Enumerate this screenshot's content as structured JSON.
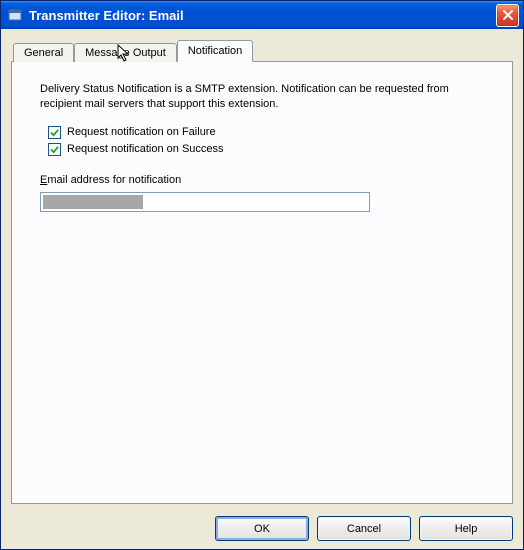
{
  "window": {
    "title": "Transmitter Editor: Email"
  },
  "tabs": {
    "general": "General",
    "message_output": "Message Output",
    "notification": "Notification"
  },
  "panel": {
    "description": "Delivery Status Notification is a SMTP extension. Notification can be requested from recipient mail servers that support this extension.",
    "chk_failure": "Request notification on Failure",
    "chk_success": "Request notification on Success",
    "email_label_prefix": "E",
    "email_label_rest": "mail address for notification",
    "email_value": ""
  },
  "buttons": {
    "ok": "OK",
    "cancel": "Cancel",
    "help": "Help"
  }
}
